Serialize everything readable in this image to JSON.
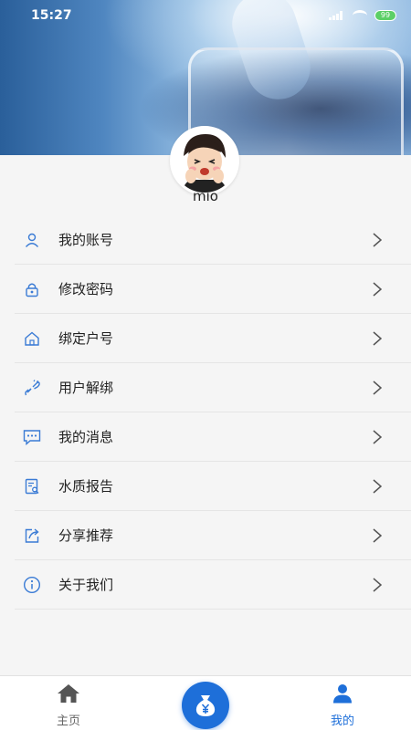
{
  "status_bar": {
    "time": "15:27",
    "battery": "99"
  },
  "profile": {
    "username": "mio"
  },
  "menu": [
    {
      "label": "我的账号",
      "icon": "user-icon"
    },
    {
      "label": "修改密码",
      "icon": "lock-icon"
    },
    {
      "label": "绑定户号",
      "icon": "home-icon"
    },
    {
      "label": "用户解绑",
      "icon": "unlink-icon"
    },
    {
      "label": "我的消息",
      "icon": "message-icon"
    },
    {
      "label": "水质报告",
      "icon": "report-icon"
    },
    {
      "label": "分享推荐",
      "icon": "share-icon"
    },
    {
      "label": "关于我们",
      "icon": "info-icon"
    }
  ],
  "tabbar": {
    "home_label": "主页",
    "mine_label": "我的",
    "center_icon": "money-bag-icon"
  },
  "colors": {
    "accent": "#1e6fd9",
    "icon": "#3a7bd5",
    "text": "#222222"
  }
}
